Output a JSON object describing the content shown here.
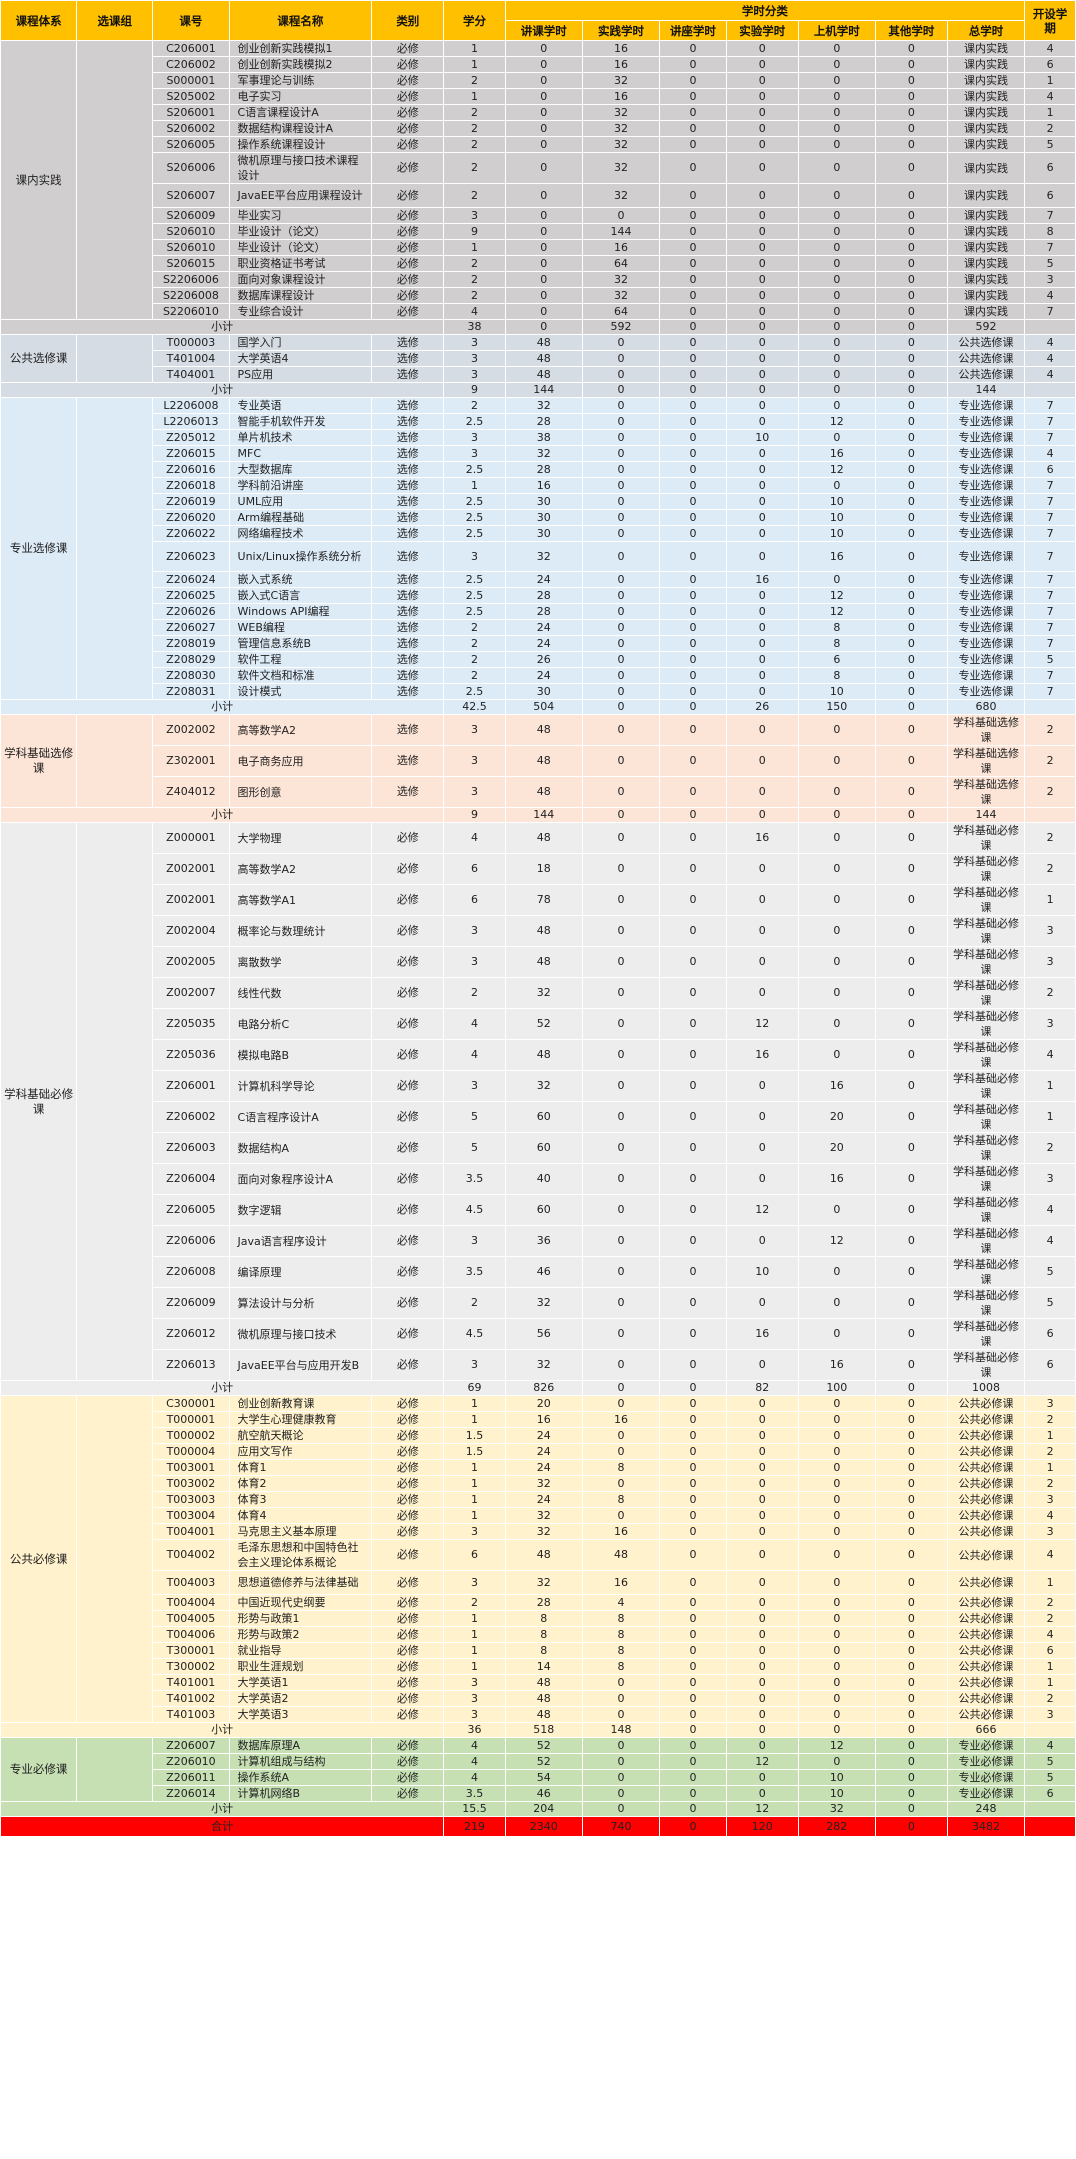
{
  "headers": {
    "system": "课程体系",
    "group": "选课组",
    "code": "课号",
    "name": "课程名称",
    "kind": "类别",
    "credit": "学分",
    "hours_cat": "学时分类",
    "lecture": "讲课学时",
    "practice": "实践学时",
    "seminar": "讲座学时",
    "experiment": "实验学时",
    "computer": "上机学时",
    "other": "其他学时",
    "total": "总学时",
    "term": "开设学期"
  },
  "subtotal_label": "小计",
  "total_label": "合计",
  "sections": [
    {
      "name": "课内实践",
      "color": "#d0cece",
      "rows": [
        [
          "C206001",
          "创业创新实践模拟1",
          "必修",
          "1",
          "0",
          "16",
          "0",
          "0",
          "0",
          "0",
          "课内实践",
          "4"
        ],
        [
          "C206002",
          "创业创新实践模拟2",
          "必修",
          "1",
          "0",
          "16",
          "0",
          "0",
          "0",
          "0",
          "课内实践",
          "6"
        ],
        [
          "S000001",
          "军事理论与训练",
          "必修",
          "2",
          "0",
          "32",
          "0",
          "0",
          "0",
          "0",
          "课内实践",
          "1"
        ],
        [
          "S205002",
          "电子实习",
          "必修",
          "1",
          "0",
          "16",
          "0",
          "0",
          "0",
          "0",
          "课内实践",
          "4"
        ],
        [
          "S206001",
          "C语言课程设计A",
          "必修",
          "2",
          "0",
          "32",
          "0",
          "0",
          "0",
          "0",
          "课内实践",
          "1"
        ],
        [
          "S206002",
          "数据结构课程设计A",
          "必修",
          "2",
          "0",
          "32",
          "0",
          "0",
          "0",
          "0",
          "课内实践",
          "2"
        ],
        [
          "S206005",
          "操作系统课程设计",
          "必修",
          "2",
          "0",
          "32",
          "0",
          "0",
          "0",
          "0",
          "课内实践",
          "5"
        ],
        [
          "S206006",
          "微机原理与接口技术课程设计",
          "必修",
          "2",
          "0",
          "32",
          "0",
          "0",
          "0",
          "0",
          "课内实践",
          "6"
        ],
        [
          "S206007",
          "JavaEE平台应用课程设计",
          "必修",
          "2",
          "0",
          "32",
          "0",
          "0",
          "0",
          "0",
          "课内实践",
          "6"
        ],
        [
          "S206009",
          "毕业实习",
          "必修",
          "3",
          "0",
          "0",
          "0",
          "0",
          "0",
          "0",
          "课内实践",
          "7"
        ],
        [
          "S206010",
          "毕业设计（论文）",
          "必修",
          "9",
          "0",
          "144",
          "0",
          "0",
          "0",
          "0",
          "课内实践",
          "8"
        ],
        [
          "S206010",
          "毕业设计（论文）",
          "必修",
          "1",
          "0",
          "16",
          "0",
          "0",
          "0",
          "0",
          "课内实践",
          "7"
        ],
        [
          "S206015",
          "职业资格证书考试",
          "必修",
          "2",
          "0",
          "64",
          "0",
          "0",
          "0",
          "0",
          "课内实践",
          "5"
        ],
        [
          "S2206006",
          "面向对象课程设计",
          "必修",
          "2",
          "0",
          "32",
          "0",
          "0",
          "0",
          "0",
          "课内实践",
          "3"
        ],
        [
          "S2206008",
          "数据库课程设计",
          "必修",
          "2",
          "0",
          "32",
          "0",
          "0",
          "0",
          "0",
          "课内实践",
          "4"
        ],
        [
          "S2206010",
          "专业综合设计",
          "必修",
          "4",
          "0",
          "64",
          "0",
          "0",
          "0",
          "0",
          "课内实践",
          "7"
        ]
      ],
      "subtotal": [
        "38",
        "0",
        "592",
        "0",
        "0",
        "0",
        "0",
        "592"
      ]
    },
    {
      "name": "公共选修课",
      "color": "#d6dce4",
      "rows": [
        [
          "T000003",
          "国学入门",
          "选修",
          "3",
          "48",
          "0",
          "0",
          "0",
          "0",
          "0",
          "公共选修课",
          "4"
        ],
        [
          "T401004",
          "大学英语4",
          "选修",
          "3",
          "48",
          "0",
          "0",
          "0",
          "0",
          "0",
          "公共选修课",
          "4"
        ],
        [
          "T404001",
          "PS应用",
          "选修",
          "3",
          "48",
          "0",
          "0",
          "0",
          "0",
          "0",
          "公共选修课",
          "4"
        ]
      ],
      "subtotal": [
        "9",
        "144",
        "0",
        "0",
        "0",
        "0",
        "0",
        "144"
      ]
    },
    {
      "name": "专业选修课",
      "color": "#ddebf7",
      "rows": [
        [
          "L2206008",
          "专业英语",
          "选修",
          "2",
          "32",
          "0",
          "0",
          "0",
          "0",
          "0",
          "专业选修课",
          "7"
        ],
        [
          "L2206013",
          "智能手机软件开发",
          "选修",
          "2.5",
          "28",
          "0",
          "0",
          "0",
          "12",
          "0",
          "专业选修课",
          "7"
        ],
        [
          "Z205012",
          "单片机技术",
          "选修",
          "3",
          "38",
          "0",
          "0",
          "10",
          "0",
          "0",
          "专业选修课",
          "7"
        ],
        [
          "Z206015",
          "MFC",
          "选修",
          "3",
          "32",
          "0",
          "0",
          "0",
          "16",
          "0",
          "专业选修课",
          "4"
        ],
        [
          "Z206016",
          "大型数据库",
          "选修",
          "2.5",
          "28",
          "0",
          "0",
          "0",
          "12",
          "0",
          "专业选修课",
          "6"
        ],
        [
          "Z206018",
          "学科前沿讲座",
          "选修",
          "1",
          "16",
          "0",
          "0",
          "0",
          "0",
          "0",
          "专业选修课",
          "7"
        ],
        [
          "Z206019",
          "UML应用",
          "选修",
          "2.5",
          "30",
          "0",
          "0",
          "0",
          "10",
          "0",
          "专业选修课",
          "7"
        ],
        [
          "Z206020",
          "Arm编程基础",
          "选修",
          "2.5",
          "30",
          "0",
          "0",
          "0",
          "10",
          "0",
          "专业选修课",
          "7"
        ],
        [
          "Z206022",
          "网络编程技术",
          "选修",
          "2.5",
          "30",
          "0",
          "0",
          "0",
          "10",
          "0",
          "专业选修课",
          "7"
        ],
        [
          "Z206023",
          "Unix/Linux操作系统分析",
          "选修",
          "3",
          "32",
          "0",
          "0",
          "0",
          "16",
          "0",
          "专业选修课",
          "7"
        ],
        [
          "Z206024",
          "嵌入式系统",
          "选修",
          "2.5",
          "24",
          "0",
          "0",
          "16",
          "0",
          "0",
          "专业选修课",
          "7"
        ],
        [
          "Z206025",
          "嵌入式C语言",
          "选修",
          "2.5",
          "28",
          "0",
          "0",
          "0",
          "12",
          "0",
          "专业选修课",
          "7"
        ],
        [
          "Z206026",
          "Windows API编程",
          "选修",
          "2.5",
          "28",
          "0",
          "0",
          "0",
          "12",
          "0",
          "专业选修课",
          "7"
        ],
        [
          "Z206027",
          "WEB编程",
          "选修",
          "2",
          "24",
          "0",
          "0",
          "0",
          "8",
          "0",
          "专业选修课",
          "7"
        ],
        [
          "Z208019",
          "管理信息系统B",
          "选修",
          "2",
          "24",
          "0",
          "0",
          "0",
          "8",
          "0",
          "专业选修课",
          "7"
        ],
        [
          "Z208029",
          "软件工程",
          "选修",
          "2",
          "26",
          "0",
          "0",
          "0",
          "6",
          "0",
          "专业选修课",
          "5"
        ],
        [
          "Z208030",
          "软件文档和标准",
          "选修",
          "2",
          "24",
          "0",
          "0",
          "0",
          "8",
          "0",
          "专业选修课",
          "7"
        ],
        [
          "Z208031",
          "设计模式",
          "选修",
          "2.5",
          "30",
          "0",
          "0",
          "0",
          "10",
          "0",
          "专业选修课",
          "7"
        ]
      ],
      "subtotal": [
        "42.5",
        "504",
        "0",
        "0",
        "26",
        "150",
        "0",
        "680"
      ]
    },
    {
      "name": "学科基础选修课",
      "color": "#fce4d6",
      "rows": [
        [
          "Z002002",
          "高等数学A2",
          "选修",
          "3",
          "48",
          "0",
          "0",
          "0",
          "0",
          "0",
          "学科基础选修课",
          "2"
        ],
        [
          "Z302001",
          "电子商务应用",
          "选修",
          "3",
          "48",
          "0",
          "0",
          "0",
          "0",
          "0",
          "学科基础选修课",
          "2"
        ],
        [
          "Z404012",
          "图形创意",
          "选修",
          "3",
          "48",
          "0",
          "0",
          "0",
          "0",
          "0",
          "学科基础选修课",
          "2"
        ]
      ],
      "subtotal": [
        "9",
        "144",
        "0",
        "0",
        "0",
        "0",
        "0",
        "144"
      ]
    },
    {
      "name": "学科基础必修课",
      "color": "#ededed",
      "rows": [
        [
          "Z000001",
          "大学物理",
          "必修",
          "4",
          "48",
          "0",
          "0",
          "16",
          "0",
          "0",
          "学科基础必修课",
          "2"
        ],
        [
          "Z002001",
          "高等数学A2",
          "必修",
          "6",
          "18",
          "0",
          "0",
          "0",
          "0",
          "0",
          "学科基础必修课",
          "2"
        ],
        [
          "Z002001",
          "高等数学A1",
          "必修",
          "6",
          "78",
          "0",
          "0",
          "0",
          "0",
          "0",
          "学科基础必修课",
          "1"
        ],
        [
          "Z002004",
          "概率论与数理统计",
          "必修",
          "3",
          "48",
          "0",
          "0",
          "0",
          "0",
          "0",
          "学科基础必修课",
          "3"
        ],
        [
          "Z002005",
          "离散数学",
          "必修",
          "3",
          "48",
          "0",
          "0",
          "0",
          "0",
          "0",
          "学科基础必修课",
          "3"
        ],
        [
          "Z002007",
          "线性代数",
          "必修",
          "2",
          "32",
          "0",
          "0",
          "0",
          "0",
          "0",
          "学科基础必修课",
          "2"
        ],
        [
          "Z205035",
          "电路分析C",
          "必修",
          "4",
          "52",
          "0",
          "0",
          "12",
          "0",
          "0",
          "学科基础必修课",
          "3"
        ],
        [
          "Z205036",
          "模拟电路B",
          "必修",
          "4",
          "48",
          "0",
          "0",
          "16",
          "0",
          "0",
          "学科基础必修课",
          "4"
        ],
        [
          "Z206001",
          "计算机科学导论",
          "必修",
          "3",
          "32",
          "0",
          "0",
          "0",
          "16",
          "0",
          "学科基础必修课",
          "1"
        ],
        [
          "Z206002",
          "C语言程序设计A",
          "必修",
          "5",
          "60",
          "0",
          "0",
          "0",
          "20",
          "0",
          "学科基础必修课",
          "1"
        ],
        [
          "Z206003",
          "数据结构A",
          "必修",
          "5",
          "60",
          "0",
          "0",
          "0",
          "20",
          "0",
          "学科基础必修课",
          "2"
        ],
        [
          "Z206004",
          "面向对象程序设计A",
          "必修",
          "3.5",
          "40",
          "0",
          "0",
          "0",
          "16",
          "0",
          "学科基础必修课",
          "3"
        ],
        [
          "Z206005",
          "数字逻辑",
          "必修",
          "4.5",
          "60",
          "0",
          "0",
          "12",
          "0",
          "0",
          "学科基础必修课",
          "4"
        ],
        [
          "Z206006",
          "Java语言程序设计",
          "必修",
          "3",
          "36",
          "0",
          "0",
          "0",
          "12",
          "0",
          "学科基础必修课",
          "4"
        ],
        [
          "Z206008",
          "编译原理",
          "必修",
          "3.5",
          "46",
          "0",
          "0",
          "10",
          "0",
          "0",
          "学科基础必修课",
          "5"
        ],
        [
          "Z206009",
          "算法设计与分析",
          "必修",
          "2",
          "32",
          "0",
          "0",
          "0",
          "0",
          "0",
          "学科基础必修课",
          "5"
        ],
        [
          "Z206012",
          "微机原理与接口技术",
          "必修",
          "4.5",
          "56",
          "0",
          "0",
          "16",
          "0",
          "0",
          "学科基础必修课",
          "6"
        ],
        [
          "Z206013",
          "JavaEE平台与应用开发B",
          "必修",
          "3",
          "32",
          "0",
          "0",
          "0",
          "16",
          "0",
          "学科基础必修课",
          "6"
        ]
      ],
      "subtotal": [
        "69",
        "826",
        "0",
        "0",
        "82",
        "100",
        "0",
        "1008"
      ]
    },
    {
      "name": "公共必修课",
      "color": "#fff2cc",
      "rows": [
        [
          "C300001",
          "创业创新教育课",
          "必修",
          "1",
          "20",
          "0",
          "0",
          "0",
          "0",
          "0",
          "公共必修课",
          "3"
        ],
        [
          "T000001",
          "大学生心理健康教育",
          "必修",
          "1",
          "16",
          "16",
          "0",
          "0",
          "0",
          "0",
          "公共必修课",
          "2"
        ],
        [
          "T000002",
          "航空航天概论",
          "必修",
          "1.5",
          "24",
          "0",
          "0",
          "0",
          "0",
          "0",
          "公共必修课",
          "1"
        ],
        [
          "T000004",
          "应用文写作",
          "必修",
          "1.5",
          "24",
          "0",
          "0",
          "0",
          "0",
          "0",
          "公共必修课",
          "2"
        ],
        [
          "T003001",
          "体育1",
          "必修",
          "1",
          "24",
          "8",
          "0",
          "0",
          "0",
          "0",
          "公共必修课",
          "1"
        ],
        [
          "T003002",
          "体育2",
          "必修",
          "1",
          "32",
          "0",
          "0",
          "0",
          "0",
          "0",
          "公共必修课",
          "2"
        ],
        [
          "T003003",
          "体育3",
          "必修",
          "1",
          "24",
          "8",
          "0",
          "0",
          "0",
          "0",
          "公共必修课",
          "3"
        ],
        [
          "T003004",
          "体育4",
          "必修",
          "1",
          "32",
          "0",
          "0",
          "0",
          "0",
          "0",
          "公共必修课",
          "4"
        ],
        [
          "T004001",
          "马克思主义基本原理",
          "必修",
          "3",
          "32",
          "16",
          "0",
          "0",
          "0",
          "0",
          "公共必修课",
          "3"
        ],
        [
          "T004002",
          "毛泽东思想和中国特色社会主义理论体系概论",
          "必修",
          "6",
          "48",
          "48",
          "0",
          "0",
          "0",
          "0",
          "公共必修课",
          "4"
        ],
        [
          "T004003",
          "思想道德修养与法律基础",
          "必修",
          "3",
          "32",
          "16",
          "0",
          "0",
          "0",
          "0",
          "公共必修课",
          "1"
        ],
        [
          "T004004",
          "中国近现代史纲要",
          "必修",
          "2",
          "28",
          "4",
          "0",
          "0",
          "0",
          "0",
          "公共必修课",
          "2"
        ],
        [
          "T004005",
          "形势与政策1",
          "必修",
          "1",
          "8",
          "8",
          "0",
          "0",
          "0",
          "0",
          "公共必修课",
          "2"
        ],
        [
          "T004006",
          "形势与政策2",
          "必修",
          "1",
          "8",
          "8",
          "0",
          "0",
          "0",
          "0",
          "公共必修课",
          "4"
        ],
        [
          "T300001",
          "就业指导",
          "必修",
          "1",
          "8",
          "8",
          "0",
          "0",
          "0",
          "0",
          "公共必修课",
          "6"
        ],
        [
          "T300002",
          "职业生涯规划",
          "必修",
          "1",
          "14",
          "8",
          "0",
          "0",
          "0",
          "0",
          "公共必修课",
          "1"
        ],
        [
          "T401001",
          "大学英语1",
          "必修",
          "3",
          "48",
          "0",
          "0",
          "0",
          "0",
          "0",
          "公共必修课",
          "1"
        ],
        [
          "T401002",
          "大学英语2",
          "必修",
          "3",
          "48",
          "0",
          "0",
          "0",
          "0",
          "0",
          "公共必修课",
          "2"
        ],
        [
          "T401003",
          "大学英语3",
          "必修",
          "3",
          "48",
          "0",
          "0",
          "0",
          "0",
          "0",
          "公共必修课",
          "3"
        ]
      ],
      "subtotal": [
        "36",
        "518",
        "148",
        "0",
        "0",
        "0",
        "0",
        "666"
      ]
    },
    {
      "name": "专业必修课",
      "color": "#c6e0b4",
      "rows": [
        [
          "Z206007",
          "数据库原理A",
          "必修",
          "4",
          "52",
          "0",
          "0",
          "0",
          "12",
          "0",
          "专业必修课",
          "4"
        ],
        [
          "Z206010",
          "计算机组成与结构",
          "必修",
          "4",
          "52",
          "0",
          "0",
          "12",
          "0",
          "0",
          "专业必修课",
          "5"
        ],
        [
          "Z206011",
          "操作系统A",
          "必修",
          "4",
          "54",
          "0",
          "0",
          "0",
          "10",
          "0",
          "专业必修课",
          "5"
        ],
        [
          "Z206014",
          "计算机网络B",
          "必修",
          "3.5",
          "46",
          "0",
          "0",
          "0",
          "10",
          "0",
          "专业必修课",
          "6"
        ]
      ],
      "subtotal": [
        "15.5",
        "204",
        "0",
        "0",
        "12",
        "32",
        "0",
        "248"
      ]
    }
  ],
  "total": [
    "219",
    "2340",
    "740",
    "0",
    "120",
    "282",
    "0",
    "3482"
  ]
}
